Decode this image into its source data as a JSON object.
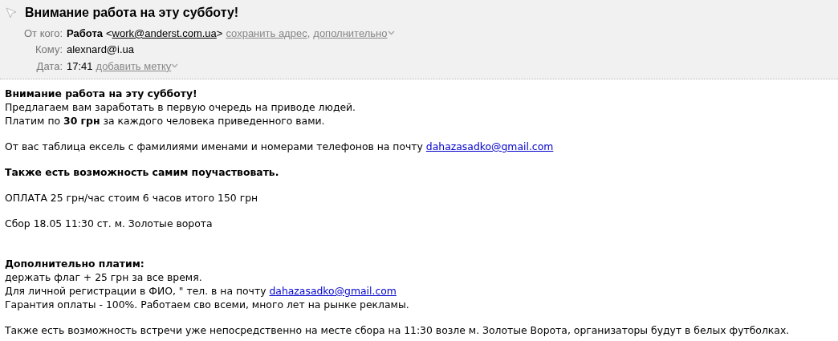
{
  "header": {
    "subject": "Внимание работа на эту субботу!",
    "from": {
      "label": "От кого:",
      "name": "Работа",
      "open": "<",
      "email": "work@anderst.com.ua",
      "close": ">",
      "links": [
        "сохранить адрес",
        "дополнительно"
      ],
      "separator": ","
    },
    "to": {
      "label": "Кому:",
      "value": "alexnard@i.ua"
    },
    "date": {
      "label": "Дата:",
      "value": "17:41",
      "link": "добавить метку"
    }
  },
  "body": [
    {
      "lines": [
        {
          "kind": "bold",
          "text": "Внимание работа на эту субботу!"
        },
        {
          "kind": "text",
          "text": "Предлагаем вам заработать в первую очередь на приводе людей."
        },
        {
          "kind": "text",
          "text": "Платим по **30 грн** за каждого человека приведенного вами."
        }
      ]
    },
    {
      "lines": [
        {
          "kind": "link",
          "text": "От вас таблица ексель с фамилиями именами и номерами телефонов на почту",
          "link": "dahazasadko@gmail.com"
        }
      ]
    },
    {
      "lines": [
        {
          "kind": "bold",
          "text": "Также есть возможность самим поучаствовать."
        }
      ]
    },
    {
      "lines": [
        {
          "kind": "text",
          "text": "ОПЛАТА 25 грн/час стоим 6 часов итого 150 грн"
        }
      ]
    },
    {
      "lines": [
        {
          "kind": "text",
          "text": "Сбор 18.05 11:30 ст. м. Золотые ворота"
        }
      ]
    },
    {
      "lines": [
        {
          "kind": "bold",
          "text": "Дополнительно платим:"
        },
        {
          "kind": "text",
          "text": "держать флаг + 25 грн за все время."
        },
        {
          "kind": "link",
          "text": "Для личной регистрации в ФИО, \" тел. в на почту",
          "link": "dahazasadko@gmail.com"
        },
        {
          "kind": "text",
          "text": "Гарантия оплаты - 100%. Работаем сво всеми, много лет на рынке рекламы."
        }
      ]
    },
    {
      "lines": [
        {
          "kind": "text",
          "text": "Также есть возможность встречи уже непосредственно на месте сбора на 11:30 возле м. Золотые Ворота, организаторы будут в белых футболках."
        }
      ]
    }
  ]
}
